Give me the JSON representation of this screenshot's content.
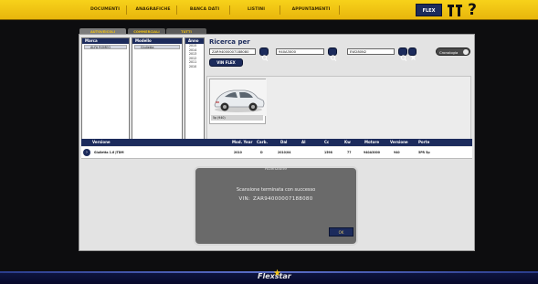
{
  "menu": {
    "items": [
      "DOCUMENTI",
      "ANAGRAFICHE",
      "BANCA DATI",
      "LISTINI",
      "APPUNTAMENTI"
    ],
    "flex_label": "FLEX",
    "help_label": "?"
  },
  "tabs": [
    "AUTOVEICOLI",
    "COMMERCIALI",
    "TUTTI"
  ],
  "columns": {
    "marca": {
      "header": "Marca",
      "selected": "ALFA ROMEO"
    },
    "modello": {
      "header": "Modello",
      "selected": "Giulietta"
    },
    "anno": {
      "header": "Anno",
      "years": [
        "2015",
        "2014",
        "2013",
        "2012",
        "2011",
        "2010"
      ]
    }
  },
  "search": {
    "title": "Ricerca per",
    "vin_value": "ZAR94000007188080",
    "code1_value": "940A3000",
    "code2_value": "EW280N2",
    "vin_flex_label": "VIN FLEX",
    "cronologia_label": "Cronologia"
  },
  "result_card": {
    "label": "5p (940)"
  },
  "results": {
    "headers": {
      "versione": "Versione",
      "mod_year": "Mod. Year",
      "carb": "Carb.",
      "dal": "Dal",
      "al": "Al",
      "cc": "Cc",
      "kw": "Kw",
      "motore": "Motore",
      "versione2": "Versione",
      "porte": "Porte"
    },
    "row": {
      "versione": "Giulietta 1.6 JTDM",
      "mod_year": "2010",
      "carb": "D",
      "dal": "2010/04",
      "al": "",
      "cc": "1598",
      "kw": "77",
      "motore": "940A3000",
      "versione2": "940",
      "porte": "5PR 5p"
    }
  },
  "modal": {
    "title": "Attenzione",
    "message": "Scansione terminata con successo",
    "vin_label": "VIN:",
    "vin_value": "ZAR94000007188080",
    "ok_label": "OK"
  },
  "footer": {
    "logo_text": "Flexstar",
    "star": "★"
  },
  "colors": {
    "accent": "#f2c313",
    "navy": "#1c2b5c"
  }
}
